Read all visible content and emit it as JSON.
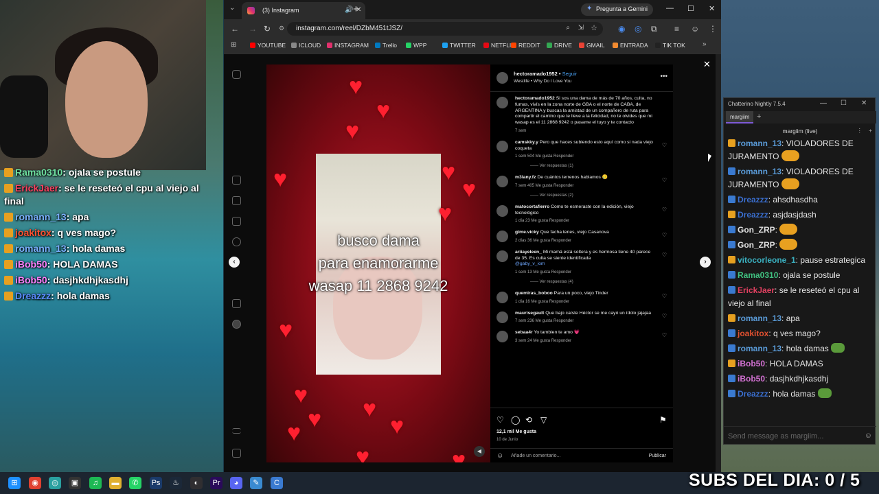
{
  "overlay_chat": [
    {
      "user": "Rama0310",
      "text": "ojala se postule"
    },
    {
      "user": "ErickJaer",
      "text": "se le reseteó el cpu al viejo al final"
    },
    {
      "user": "romann_13",
      "text": "apa"
    },
    {
      "user": "joakitox",
      "text": "q ves mago?"
    },
    {
      "user": "romann_13",
      "text": "hola damas"
    },
    {
      "user": "iBob50",
      "text": "HOLA DAMAS"
    },
    {
      "user": "iBob50",
      "text": "dasjhkdhjkasdhj"
    },
    {
      "user": "Dreazzz",
      "text": "hola damas"
    }
  ],
  "browser": {
    "tab_title": "(3) Instagram",
    "gemini": "Pregunta a Gemini",
    "url": "instagram.com/reel/DZbM451tJSZ/",
    "bookmarks": [
      "YOUTUBE",
      "ICLOUD",
      "INSTAGRAM",
      "Trello",
      "WPP",
      "TWITTER",
      "NETFLIX",
      "REDDIT",
      "DRIVE",
      "GMAIL",
      "ENTRADA",
      "TIK TOK"
    ]
  },
  "reel": {
    "caption_lines": [
      "busco dama",
      "para enamorarme",
      "wasap 11 2868 9242"
    ]
  },
  "post": {
    "author": "hectoramado1952",
    "follow": "Seguir",
    "song": "Westlife • Why Do I Love You",
    "likes": "12,1 mil Me gusta",
    "date": "10 de Junio",
    "add_comment_placeholder": "Añade un comentario...",
    "publish": "Publicar",
    "comments": [
      {
        "user": "hectoramado1952",
        "text": "Si sos una dama de más de 70 años, culta, no fumas, vivís en la zona norte de GBA o el norte de CABA, de ARGENTINA y buscas la amistad de un compañero de ruta para compartir el camino que te lleve a la felicidad, no te olvides que mi wasap es el 11 2868 9242 o pasame el tuyo y te contacto",
        "meta": "7 sem",
        "replies": ""
      },
      {
        "user": "camskky.y",
        "text": "Pero que haces subiendo esto aquí como si nada viejo coqueta",
        "meta": "1 sem   504 Me gusta   Responder",
        "replies": "Ver respuestas (1)"
      },
      {
        "user": "m3lany.fz",
        "text": "De cuántos terrenos hablamos 🥲",
        "meta": "7 sem   405 Me gusta   Responder",
        "replies": "Ver respuestas (2)"
      },
      {
        "user": "matocortafierro",
        "text": "Como te esmeraste con la edición, viejo tecnológico",
        "meta": "1 día   23 Me gusta   Responder",
        "replies": ""
      },
      {
        "user": "gime.vicky",
        "text": "Que facha tenes, viejo Casanova",
        "meta": "2 días   36 Me gusta   Responder",
        "replies": ""
      },
      {
        "user": "ariiayeleen_",
        "text": "Mi mamá está soltera y es hermosa tiene 40 parece de 35. Es culta se siente identificada",
        "tag": "@gaby_v_iom",
        "meta": "1 sem   13 Me gusta   Responder",
        "replies": "Ver respuestas (4)"
      },
      {
        "user": "quemiras_boboo",
        "text": "Para un poco, viejo Tinder",
        "meta": "1 día   16 Me gusta   Responder",
        "replies": ""
      },
      {
        "user": "maurisegault",
        "text": "Que bajo caíste Héctor se me cayó un ídolo jajajaa",
        "meta": "7 sem   236 Me gusta   Responder",
        "replies": ""
      },
      {
        "user": "sebaa4r",
        "text": "Yo tambien te amo 💗",
        "meta": "3 sem   24 Me gusta   Responder",
        "replies": ""
      }
    ]
  },
  "chatterino": {
    "title": "Chatterino Nightly 7.5.4",
    "tab": "margiim",
    "channel": "margiim (live)",
    "input_placeholder": "Send message as margiim...",
    "messages": [
      {
        "user": "romann_13",
        "text": "VIOLADORES DE JURAMENTO",
        "color": "#5a9bd8"
      },
      {
        "user": "romann_13",
        "text": "VIOLADORES DE JURAMENTO",
        "color": "#5a9bd8"
      },
      {
        "user": "Dreazzz",
        "text": "ahsdhasdha",
        "color": "#3a6fd0"
      },
      {
        "user": "Dreazzz",
        "text": "asjdasjdash",
        "color": "#3a6fd0"
      },
      {
        "user": "Gon_ZRP",
        "text": "",
        "color": "#e0e0e0"
      },
      {
        "user": "Gon_ZRP",
        "text": "",
        "color": "#e0e0e0"
      },
      {
        "user": "vitocorleone_1",
        "text": "pause estrategica",
        "color": "#3ab0c0"
      },
      {
        "user": "Rama0310",
        "text": "ojala se postule",
        "color": "#40c080"
      },
      {
        "user": "ErickJaer",
        "text": "se le reseteó el cpu al viejo al final",
        "color": "#e04060"
      },
      {
        "user": "romann_13",
        "text": "apa",
        "color": "#5a9bd8"
      },
      {
        "user": "joakitox",
        "text": "q ves mago?",
        "color": "#e05030"
      },
      {
        "user": "romann_13",
        "text": "hola damas",
        "color": "#5a9bd8"
      },
      {
        "user": "iBob50",
        "text": "HOLA DAMAS",
        "color": "#d070d0"
      },
      {
        "user": "iBob50",
        "text": "dasjhkdhjkasdhj",
        "color": "#d070d0"
      },
      {
        "user": "Dreazzz",
        "text": "hola damas",
        "color": "#3a6fd0"
      }
    ]
  },
  "stream": {
    "subs": "SUBS DEL DIA: 0 / 5"
  }
}
